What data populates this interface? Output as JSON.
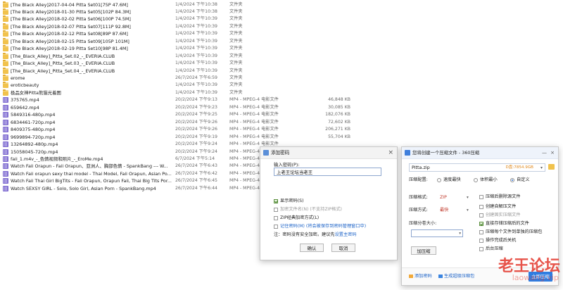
{
  "files": [
    {
      "name": "[The Black Alley]2017-04-04 Pitta Set01[75P 47.6M]",
      "date": "1/4/2024 下午10:38",
      "type": "文件夹",
      "size": "",
      "kind": "folder"
    },
    {
      "name": "[The Black Alley]2018-01-30 Pitta Set05[102P 84.3M]",
      "date": "1/4/2024 下午10:38",
      "type": "文件夹",
      "size": "",
      "kind": "folder"
    },
    {
      "name": "[The Black Alley]2018-02-02 Pitta Set06[100P 74.5M]",
      "date": "1/4/2024 下午10:39",
      "type": "文件夹",
      "size": "",
      "kind": "folder"
    },
    {
      "name": "[The Black Alley]2018-02-07 Pitta Set07[111P 92.8M]",
      "date": "1/4/2024 下午10:39",
      "type": "文件夹",
      "size": "",
      "kind": "folder"
    },
    {
      "name": "[The Black Alley]2018-02-12 Pitta Set08[89P 87.6M]",
      "date": "1/4/2024 下午10:39",
      "type": "文件夹",
      "size": "",
      "kind": "folder"
    },
    {
      "name": "[The Black Alley]2018-02-15 Pitta Set09[105P 101M]",
      "date": "1/4/2024 下午10:39",
      "type": "文件夹",
      "size": "",
      "kind": "folder"
    },
    {
      "name": "[The Black Alley]2018-02-19 Pitta Set10[98P 81.4M]",
      "date": "1/4/2024 下午10:39",
      "type": "文件夹",
      "size": "",
      "kind": "folder"
    },
    {
      "name": "[The_Black_Alley]_Pitta_Set.02_-_EVERIA.CLUB",
      "date": "1/4/2024 下午10:39",
      "type": "文件夹",
      "size": "",
      "kind": "folder"
    },
    {
      "name": "[The_Black_Alley]_Pitta_Set.03_-_EVERIA.CLUB",
      "date": "1/4/2024 下午10:39",
      "type": "文件夹",
      "size": "",
      "kind": "folder"
    },
    {
      "name": "[The_Black_Alley]_Pitta_Set.04_-_EVERIA.CLUB",
      "date": "1/4/2024 下午10:39",
      "type": "文件夹",
      "size": "",
      "kind": "folder"
    },
    {
      "name": "erome",
      "date": "26/7/2024 下午6:59",
      "type": "文件夹",
      "size": "",
      "kind": "folder"
    },
    {
      "name": "eroticbeauty",
      "date": "1/4/2024 下午10:39",
      "type": "文件夹",
      "size": "",
      "kind": "folder"
    },
    {
      "name": "极品女神Pitta熊猫光着图",
      "date": "1/4/2024 下午10:39",
      "type": "文件夹",
      "size": "",
      "kind": "folder"
    },
    {
      "name": "375765.mp4",
      "date": "20/2/2024 下午9:13",
      "type": "MP4 - MPEG-4 电影文件",
      "size": "46,848 KB",
      "kind": "video"
    },
    {
      "name": "659642.mp4",
      "date": "20/2/2024 下午9:23",
      "type": "MP4 - MPEG-4 电影文件",
      "size": "30,085 KB",
      "kind": "video"
    },
    {
      "name": "5849316-480p.mp4",
      "date": "20/2/2024 下午9:25",
      "type": "MP4 - MPEG-4 电影文件",
      "size": "182,076 KB",
      "kind": "video"
    },
    {
      "name": "6834461-720p.mp4",
      "date": "20/2/2024 下午9:26",
      "type": "MP4 - MPEG-4 电影文件",
      "size": "72,602 KB",
      "kind": "video"
    },
    {
      "name": "8409375-480p.mp4",
      "date": "20/2/2024 下午9:26",
      "type": "MP4 - MPEG-4 电影文件",
      "size": "206,271 KB",
      "kind": "video"
    },
    {
      "name": "9699894-720p.mp4",
      "date": "20/2/2024 下午9:19",
      "type": "MP4 - MPEG-4 电影文件",
      "size": "55,704 KB",
      "kind": "video"
    },
    {
      "name": "13264892-480p.mp4",
      "date": "20/2/2024 下午9:24",
      "type": "MP4 - MPEG-4 电影文件",
      "size": "",
      "kind": "video"
    },
    {
      "name": "15058045-720p.mp4",
      "date": "20/2/2024 下午9:24",
      "type": "MP4 - MPEG-4 电影文件",
      "size": "",
      "kind": "video"
    },
    {
      "name": "faii_1.m4v_-_色情视频和照片_-_EroMe.mp4",
      "date": "6/7/2024 下午5:14",
      "type": "MP4 - MPEG-4 电影文件",
      "size": "",
      "kind": "video"
    },
    {
      "name": "Watch Faii Orapun - Faii Orapun、亚洲人、胸部色情 - SpankBang --- W...",
      "date": "26/7/2024 下午6:43",
      "type": "MP4 - MPEG-4 电影文件",
      "size": "",
      "kind": "video"
    },
    {
      "name": "Watch Faii orapun sexy thai model - Thai Model, Faii Orapun, Asian Po...",
      "date": "26/7/2024 下午6:42",
      "type": "MP4 - MPEG-4 电影文件",
      "size": "",
      "kind": "video"
    },
    {
      "name": "Watch Faii Thai Girl BigTits - Faii Orapun, Orapun Faii, Thai Big Tits Por...",
      "date": "26/7/2024 下午6:45",
      "type": "MP4 - MPEG-4 电影文件",
      "size": "",
      "kind": "video"
    },
    {
      "name": "Watch SEXSY GIRL - Solo, Solo Girl, Asian Porn - SpankBang.mp4",
      "date": "26/7/2024 下午6:44",
      "type": "MP4 - MPEG-4 电影文件",
      "size": "",
      "kind": "video"
    }
  ],
  "password_dialog": {
    "title": "添加密码",
    "close": "×",
    "label": "输入密码(P):",
    "value": "上老王论坛当老王",
    "show_password": "显示密码(S)",
    "encrypt_filenames": "加密文件名(N) (不支持ZIP格式)",
    "zip_legacy": "ZIP经典加密方式(L)",
    "remember": "记住密码(M)",
    "remember_note": "(将会被保存到密码管理窗口中)",
    "note_prefix": "注：密码没有安全加密。建议先",
    "note_link": "设置主密码",
    "ok": "确认",
    "cancel": "取消"
  },
  "archive_dialog": {
    "title": "您将创建一个压缩文件 - 360压缩",
    "minimize": "—",
    "close": "×",
    "filename": "Pitta.zip",
    "free_space": "D盘:7854.9GB",
    "mode_label": "压缩配置:",
    "modes": [
      "速度最快",
      "体积最小",
      "自定义"
    ],
    "format_label": "压缩格式:",
    "format_value": "ZIP",
    "method_label": "压缩方式:",
    "method_value": "最快",
    "volume_label": "压缩分卷大小:",
    "add_password": "加压缩",
    "options": [
      {
        "label": "压缩后删除源文件",
        "checked": false,
        "enabled": true
      },
      {
        "label": "创建自解压文件",
        "checked": false,
        "enabled": true
      },
      {
        "label": "创建固实压缩文件",
        "checked": false,
        "enabled": false
      },
      {
        "label": "直接存储压缩后的文件",
        "checked": true,
        "enabled": true
      },
      {
        "label": "压缩每个文件到单独的压缩包",
        "checked": false,
        "enabled": true
      },
      {
        "label": "操作完成后关机",
        "checked": false,
        "enabled": true
      },
      {
        "label": "后台压缩",
        "checked": false,
        "enabled": true
      }
    ],
    "footer_password": "添加密码",
    "footer_super": "生成超级压缩包",
    "start": "立即压缩"
  },
  "watermark": {
    "main": "老王论坛",
    "sub": "laowang.vip"
  },
  "colors": {
    "folder": "#f1c24c",
    "video": "#7e6bd1",
    "accent": "#2f7de1",
    "watermark": "#e3372c"
  }
}
